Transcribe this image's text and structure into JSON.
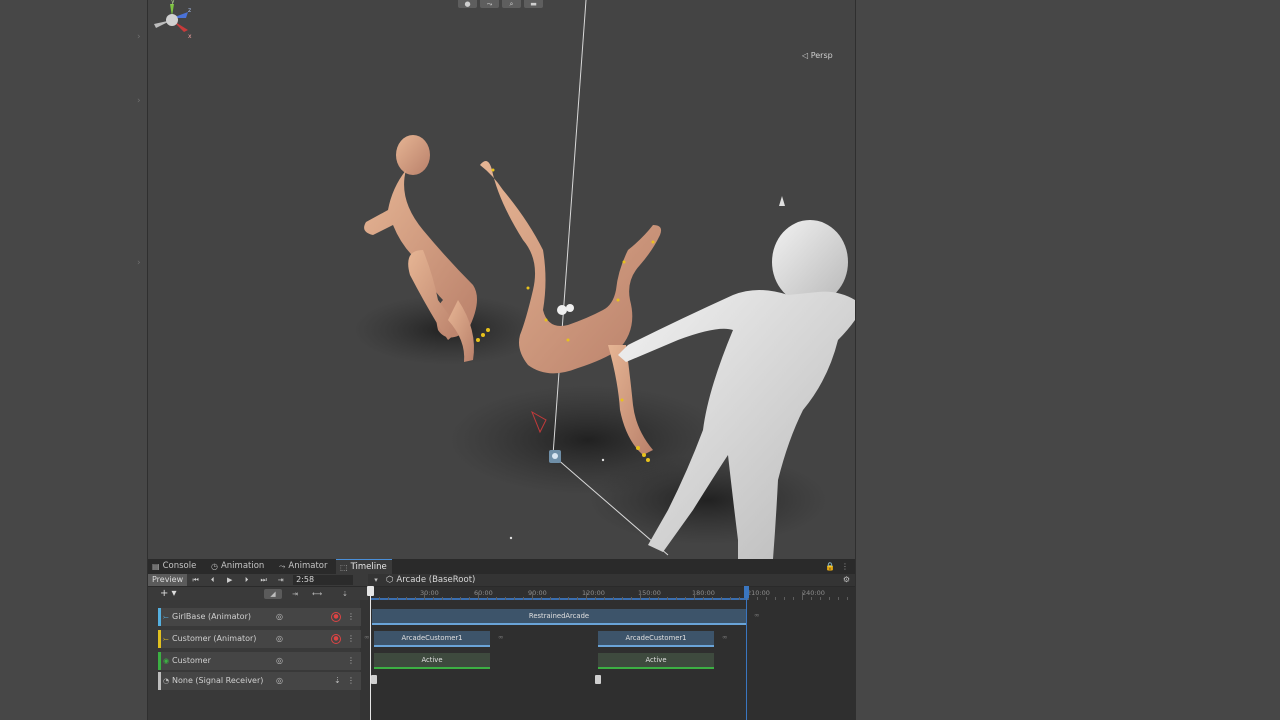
{
  "scene": {
    "toolbar": [
      "●",
      "⤳",
      "⌕",
      "▬"
    ],
    "projection_label": "◁ Persp",
    "gizmo_axes": [
      "y",
      "z",
      "x"
    ]
  },
  "tabs": [
    {
      "label": "Console",
      "icon": "▤"
    },
    {
      "label": "Animation",
      "icon": "◷"
    },
    {
      "label": "Animator",
      "icon": "⤳"
    },
    {
      "label": "Timeline",
      "icon": "⬚",
      "active": true
    }
  ],
  "tab_tools": {
    "lock": "🔒",
    "more": "⋮"
  },
  "timeline": {
    "preview_label": "Preview",
    "controls": [
      "⏮",
      "⏴",
      "▶",
      "⏵",
      "⏭",
      "⇥"
    ],
    "time_value": "2:58",
    "dropdown": "▾",
    "asset_label": "Arcade (BaseRoot)",
    "add_label": "+ ▾",
    "ruler_labels": [
      "30:00",
      "60:00",
      "90:00",
      "120:00",
      "150:00",
      "180:00",
      "210:00",
      "240:00"
    ],
    "tracks": [
      {
        "name": "GirlBase (Animator)",
        "icon": "⤚",
        "accent": "#55b0e0",
        "clips": [
          {
            "label": "RestrainedArcade"
          }
        ],
        "markers": [
          "∞"
        ]
      },
      {
        "name": "Customer (Animator)",
        "icon": "⤚",
        "accent": "#e0c020",
        "clips": [
          {
            "label": "ArcadeCustomer1"
          },
          {
            "label": "ArcadeCustomer1"
          }
        ],
        "markers": [
          "∞",
          "∞",
          "∞"
        ]
      },
      {
        "name": "Customer",
        "icon": "◉",
        "accent": "#3cb043",
        "clips": [
          {
            "label": "Active"
          },
          {
            "label": "Active"
          }
        ]
      },
      {
        "name": "None (Signal Receiver)",
        "icon": "◔",
        "accent": "#bdbdbd"
      }
    ]
  }
}
